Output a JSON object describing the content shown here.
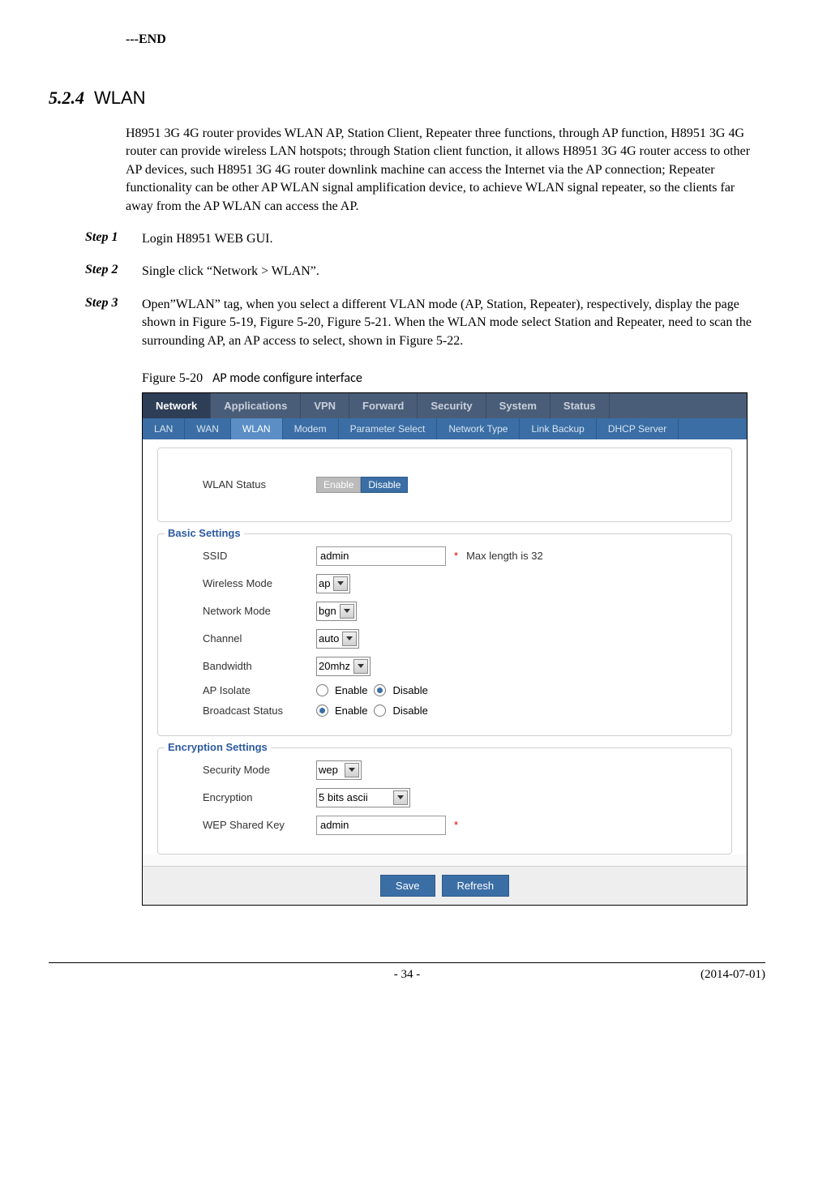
{
  "end_marker": "---END",
  "section": {
    "number": "5.2.4",
    "title": "WLAN"
  },
  "intro": "H8951 3G 4G router    provides WLAN AP, Station Client, Repeater three functions, through AP function, H8951 3G 4G router    can provide wireless LAN hotspots; through Station client function, it allows H8951 3G 4G router    access to other AP devices, such H8951 3G 4G router    downlink machine can access the Internet via the AP connection; Repeater functionality can be other AP WLAN signal amplification device, to achieve WLAN signal repeater, so the clients far away from the AP WLAN can access the AP.",
  "steps": [
    {
      "label": "Step 1",
      "text": "Login H8951 WEB GUI."
    },
    {
      "label": "Step 2",
      "text": "Single click “Network > WLAN”."
    },
    {
      "label": "Step 3",
      "text": "Open”WLAN” tag, when you select a different VLAN mode (AP, Station, Repeater), respectively, display the page shown in Figure 5-19, Figure 5-20, Figure 5-21. When the WLAN mode select Station and Repeater, need to scan the surrounding AP, an AP access to select, shown in Figure 5-22."
    }
  ],
  "figure": {
    "label": "Figure 5-20",
    "title": "AP mode configure interface"
  },
  "ui": {
    "main_tabs": [
      "Network",
      "Applications",
      "VPN",
      "Forward",
      "Security",
      "System",
      "Status"
    ],
    "main_tab_active_index": 0,
    "sub_tabs": [
      "LAN",
      "WAN",
      "WLAN",
      "Modem",
      "Parameter Select",
      "Network Type",
      "Link Backup",
      "DHCP Server"
    ],
    "sub_tab_active_index": 2,
    "status_section": {
      "label": "WLAN Status",
      "enable": "Enable",
      "disable": "Disable",
      "selected": "Enable"
    },
    "basic": {
      "title": "Basic Settings",
      "ssid": {
        "label": "SSID",
        "value": "admin",
        "hint": "Max length is 32"
      },
      "wireless_mode": {
        "label": "Wireless Mode",
        "value": "ap"
      },
      "network_mode": {
        "label": "Network Mode",
        "value": "bgn"
      },
      "channel": {
        "label": "Channel",
        "value": "auto"
      },
      "bandwidth": {
        "label": "Bandwidth",
        "value": "20mhz"
      },
      "ap_isolate": {
        "label": "AP Isolate",
        "enable": "Enable",
        "disable": "Disable",
        "selected": "Disable"
      },
      "broadcast": {
        "label": "Broadcast Status",
        "enable": "Enable",
        "disable": "Disable",
        "selected": "Enable"
      }
    },
    "encryption": {
      "title": "Encryption Settings",
      "security_mode": {
        "label": "Security Mode",
        "value": "wep"
      },
      "encryption_type": {
        "label": "Encryption",
        "value": "5 bits ascii"
      },
      "wep_key": {
        "label": "WEP Shared Key",
        "value": "admin"
      }
    },
    "buttons": {
      "save": "Save",
      "refresh": "Refresh"
    }
  },
  "footer": {
    "page": "- 34 -",
    "date": "(2014-07-01)"
  }
}
